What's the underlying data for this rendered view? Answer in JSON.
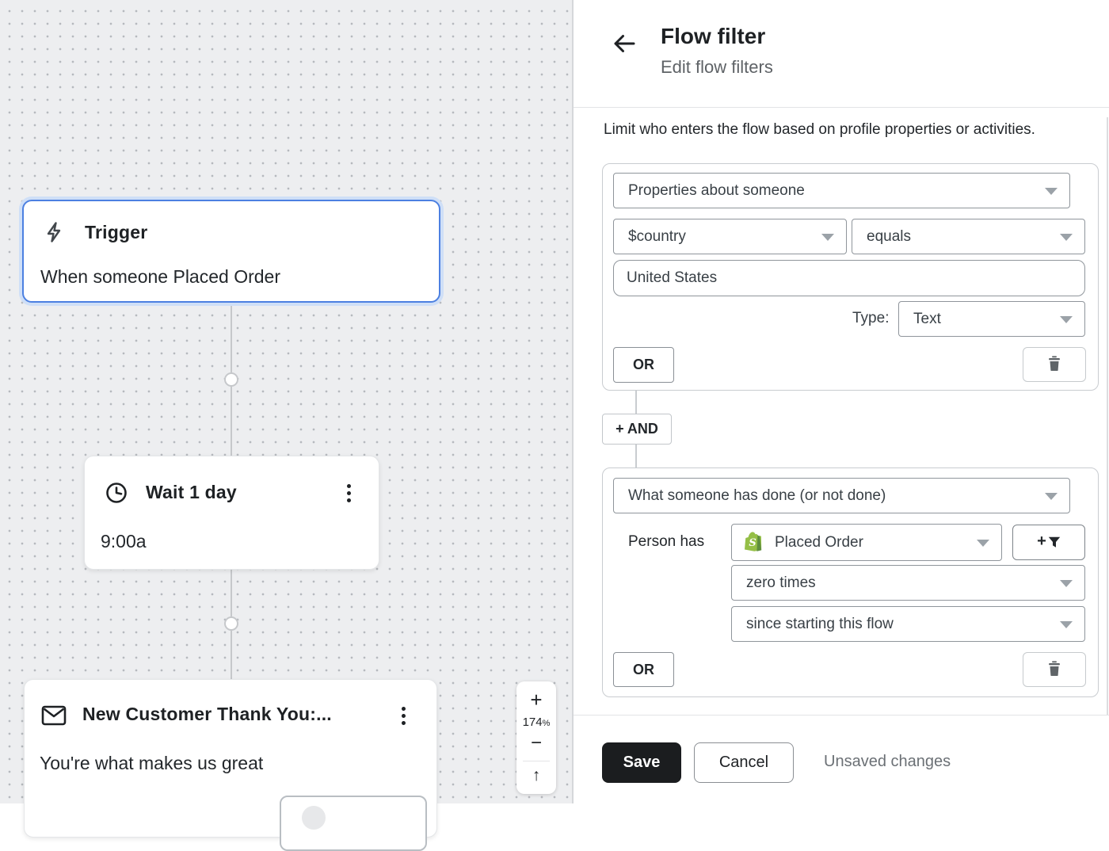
{
  "canvas": {
    "nodes": {
      "trigger": {
        "title": "Trigger",
        "subtitle": "When someone Placed Order"
      },
      "wait": {
        "title": "Wait 1 day",
        "subtitle": "9:00a"
      },
      "email": {
        "title": "New Customer Thank You:...",
        "subtitle": "You're what makes us great"
      }
    },
    "zoom": {
      "in": "+",
      "level": "174",
      "unit": "%",
      "out": "−",
      "recenter": "↑"
    }
  },
  "panel": {
    "header": {
      "title": "Flow filter",
      "subtitle": "Edit flow filters"
    },
    "description": "Limit who enters the flow based on profile properties or activities.",
    "filter_group_1": {
      "category": "Properties about someone",
      "property": "$country",
      "operator": "equals",
      "value": "United States",
      "type_label": "Type:",
      "type_value": "Text",
      "or_label": "OR"
    },
    "and_button": "+ AND",
    "filter_group_2": {
      "category": "What someone has done (or not done)",
      "person_label": "Person has",
      "event": "Placed Order",
      "frequency": "zero times",
      "timeframe": "since starting this flow",
      "filter_plus": "+",
      "or_label": "OR"
    },
    "footer": {
      "save": "Save",
      "cancel": "Cancel",
      "status": "Unsaved changes"
    }
  },
  "icons": {
    "back": "arrow-left",
    "trigger": "lightning-bolt",
    "wait": "clock",
    "email": "envelope",
    "menu": "kebab-vertical",
    "delete": "trash",
    "event_source": "shopify-bag",
    "filter": "funnel",
    "dropdown": "caret-down"
  },
  "colors": {
    "selected_node_border": "#4c80e1",
    "selected_node_glow": "#cfdff7",
    "shopify_green": "#95BF47",
    "shopify_green_dark": "#5E8E3E",
    "save_button_bg": "#1b1d1f",
    "canvas_bg": "#edeef0"
  }
}
